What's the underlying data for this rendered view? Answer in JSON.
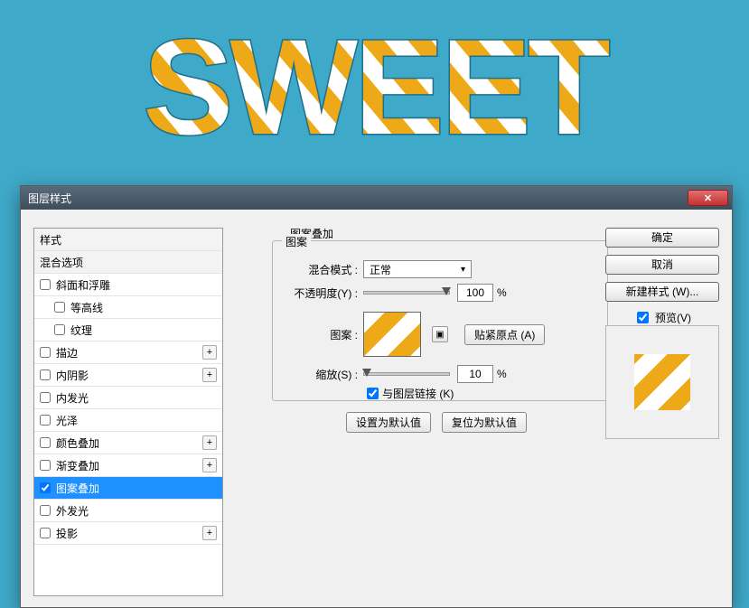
{
  "canvas": {
    "text": "SWEET"
  },
  "dialog": {
    "title": "图层样式",
    "close_tooltip": "关闭"
  },
  "styles": {
    "header": "样式",
    "blend_options": "混合选项",
    "items": [
      {
        "label": "斜面和浮雕",
        "checked": false,
        "has_sub": true
      },
      {
        "label": "等高线",
        "checked": false,
        "indent": true
      },
      {
        "label": "纹理",
        "checked": false,
        "indent": true
      },
      {
        "label": "描边",
        "checked": false,
        "plus": true
      },
      {
        "label": "内阴影",
        "checked": false,
        "plus": true
      },
      {
        "label": "内发光",
        "checked": false
      },
      {
        "label": "光泽",
        "checked": false
      },
      {
        "label": "颜色叠加",
        "checked": false,
        "plus": true
      },
      {
        "label": "渐变叠加",
        "checked": false,
        "plus": true
      },
      {
        "label": "图案叠加",
        "checked": true,
        "selected": true
      },
      {
        "label": "外发光",
        "checked": false
      },
      {
        "label": "投影",
        "checked": false,
        "plus": true
      }
    ]
  },
  "panel": {
    "title": "图案叠加",
    "group": "图案",
    "blend_mode_label": "混合模式 :",
    "blend_mode_value": "正常",
    "opacity_label": "不透明度(Y) :",
    "opacity_value": "100",
    "pct": "%",
    "pattern_label": "图案 :",
    "snap_btn": "贴紧原点 (A)",
    "scale_label": "缩放(S) :",
    "scale_value": "10",
    "link_label": "与图层链接 (K)",
    "link_checked": true,
    "set_default": "设置为默认值",
    "reset_default": "复位为默认值"
  },
  "actions": {
    "ok": "确定",
    "cancel": "取消",
    "new_style": "新建样式 (W)...",
    "preview": "预览(V)",
    "preview_checked": true
  }
}
